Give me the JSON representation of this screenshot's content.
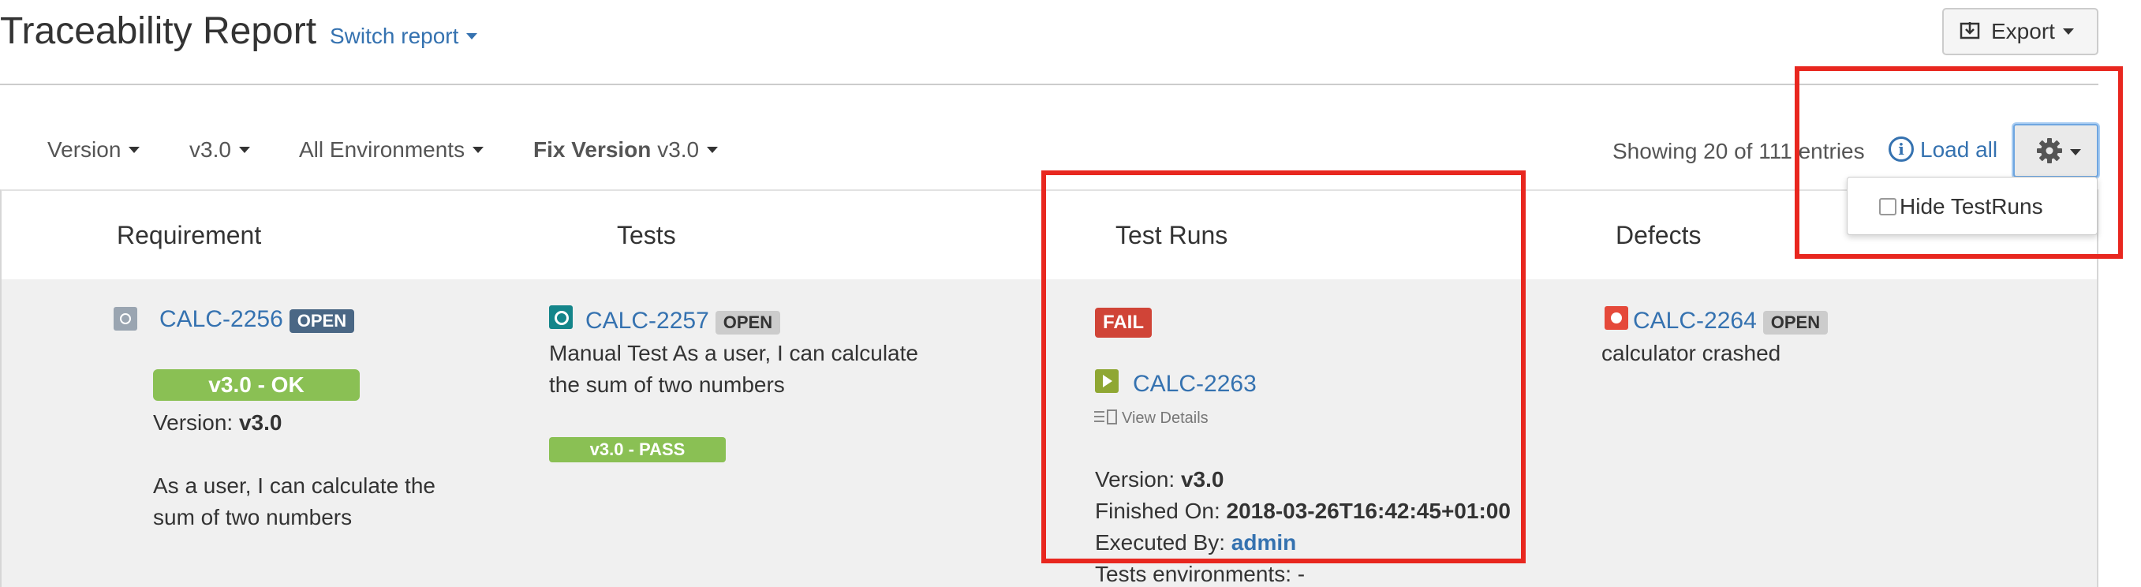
{
  "header": {
    "title": "Traceability Report",
    "switch_report": "Switch report",
    "export_label": "Export"
  },
  "filters": {
    "version": "Version",
    "version_value": "v3.0",
    "environments": "All Environments",
    "fix_version_label": "Fix Version",
    "fix_version_value": "v3.0"
  },
  "toolbar": {
    "showing": "Showing 20 of 111 entries",
    "load_all": "Load all",
    "info_glyph": "i",
    "settings_menu": {
      "hide_testruns_label": "Hide TestRuns",
      "hide_testruns_checked": false
    }
  },
  "columns": [
    "Requirement",
    "Tests",
    "Test Runs",
    "Defects"
  ],
  "row": {
    "requirement": {
      "key": "CALC-2256",
      "status": "OPEN",
      "coverage": "v3.0 - OK",
      "version_label": "Version:",
      "version_value": "v3.0",
      "summary_line1": "As a user, I can calculate the",
      "summary_line2": "sum of two numbers"
    },
    "test": {
      "key": "CALC-2257",
      "status": "OPEN",
      "summary_line1": "Manual Test As a user, I can calculate",
      "summary_line2": "the sum of two numbers",
      "result": "v3.0 - PASS"
    },
    "test_run": {
      "status": "FAIL",
      "key": "CALC-2263",
      "view_details": "View Details",
      "version_label": "Version:",
      "version_value": "v3.0",
      "finished_label": "Finished On:",
      "finished_value": "2018-03-26T16:42:45+01:00",
      "executed_label": "Executed By:",
      "executed_value": "admin",
      "environments_label": "Tests environments: -"
    },
    "defect": {
      "key": "CALC-2264",
      "status": "OPEN",
      "summary": "calculator crashed"
    }
  },
  "colors": {
    "link": "#3572b0",
    "ok_green": "#8ac054",
    "fail_red": "#d04437",
    "highlight_red": "#e8271f",
    "open_badge": "#4a6785"
  }
}
